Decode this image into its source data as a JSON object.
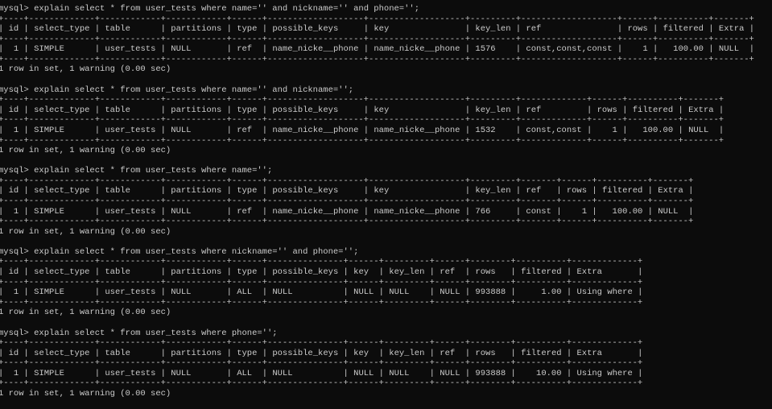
{
  "colors": {
    "background": "#0c0c0c",
    "text": "#cccccc"
  },
  "terminal": {
    "prompt": "mysql>",
    "columns": [
      "id",
      "select_type",
      "table",
      "partitions",
      "type",
      "possible_keys",
      "key",
      "key_len",
      "ref",
      "rows",
      "filtered",
      "Extra"
    ],
    "queries": [
      {
        "sql": "explain select * from user_tests where name='' and nickname='' and phone='';",
        "rows": [
          [
            "1",
            "SIMPLE",
            "user_tests",
            "NULL",
            "ref",
            "name_nicke__phone",
            "name_nicke__phone",
            "1576",
            "const,const,const",
            "1",
            "100.00",
            "NULL"
          ]
        ],
        "summary": "1 row in set, 1 warning (0.00 sec)"
      },
      {
        "sql": "explain select * from user_tests where name='' and nickname='';",
        "rows": [
          [
            "1",
            "SIMPLE",
            "user_tests",
            "NULL",
            "ref",
            "name_nicke__phone",
            "name_nicke__phone",
            "1532",
            "const,const",
            "1",
            "100.00",
            "NULL"
          ]
        ],
        "summary": "1 row in set, 1 warning (0.00 sec)"
      },
      {
        "sql": "explain select * from user_tests where name='';",
        "rows": [
          [
            "1",
            "SIMPLE",
            "user_tests",
            "NULL",
            "ref",
            "name_nicke__phone",
            "name_nicke__phone",
            "766",
            "const",
            "1",
            "100.00",
            "NULL"
          ]
        ],
        "summary": "1 row in set, 1 warning (0.00 sec)"
      },
      {
        "sql": "explain select * from user_tests where nickname='' and phone='';",
        "rows": [
          [
            "1",
            "SIMPLE",
            "user_tests",
            "NULL",
            "ALL",
            "NULL",
            "NULL",
            "NULL",
            "NULL",
            "993888",
            "1.00",
            "Using where"
          ]
        ],
        "summary": "1 row in set, 1 warning (0.00 sec)"
      },
      {
        "sql": "explain select * from user_tests where phone='';",
        "rows": [
          [
            "1",
            "SIMPLE",
            "user_tests",
            "NULL",
            "ALL",
            "NULL",
            "NULL",
            "NULL",
            "NULL",
            "993888",
            "10.00",
            "Using where"
          ]
        ],
        "summary": "1 row in set, 1 warning (0.00 sec)"
      }
    ]
  }
}
